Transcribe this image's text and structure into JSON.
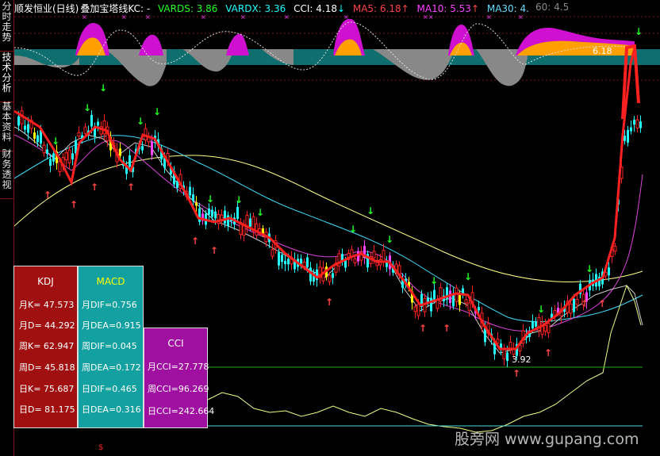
{
  "sidebar": {
    "tabs": [
      {
        "label": "分时走势",
        "active": false
      },
      {
        "label": "技术分析",
        "active": true
      },
      {
        "label": "基本资料",
        "active": false
      },
      {
        "label": "财务透视",
        "active": false
      }
    ]
  },
  "header": {
    "stock": "顺发恒业(日线)",
    "indicator": "叠加宝塔线KC",
    "sep": ": -",
    "vards": "VARDS: 3.86",
    "vardx": "VARDX: 3.36",
    "cci": "CCI: 4.18",
    "cci_arrow": "↓",
    "ma5": "MA5: 6.18",
    "ma5_arrow": "↑",
    "ma10": "MA10: 5.53",
    "ma10_arrow": "↑",
    "ma30": "MA30: 4.",
    "overflow_label": "60: 4.5"
  },
  "chart": {
    "price_label_high": "6.18",
    "price_label_low": "3.92"
  },
  "kdj_panel": {
    "title": "KDJ",
    "rows": [
      "月K= 47.573",
      "月D= 44.292",
      "周K= 62.947",
      "周D= 45.818",
      "日K= 75.687",
      "日D= 81.175"
    ]
  },
  "macd_panel": {
    "title": "MACD",
    "rows": [
      "月DIF=0.756",
      "月DEA=0.915",
      "周DIF=0.045",
      "周DEA=0.172",
      "日DIF=0.465",
      "日DEA=0.316"
    ]
  },
  "cci_panel": {
    "title": "CCI",
    "rows": [
      "月CCI=27.778",
      "周CCI=96.269",
      "日CCI=242.664"
    ]
  },
  "watermark": "股旁网 www.gupang.com",
  "bottom_mark": "$",
  "colors": {
    "up": "#ff2222",
    "down": "#00ffff",
    "yellow": "#ffff00",
    "magenta": "#ff00ff",
    "kdj_bg": "#a01010",
    "macd_bg": "#13a0a0",
    "cci_bg": "#a010a0"
  }
}
